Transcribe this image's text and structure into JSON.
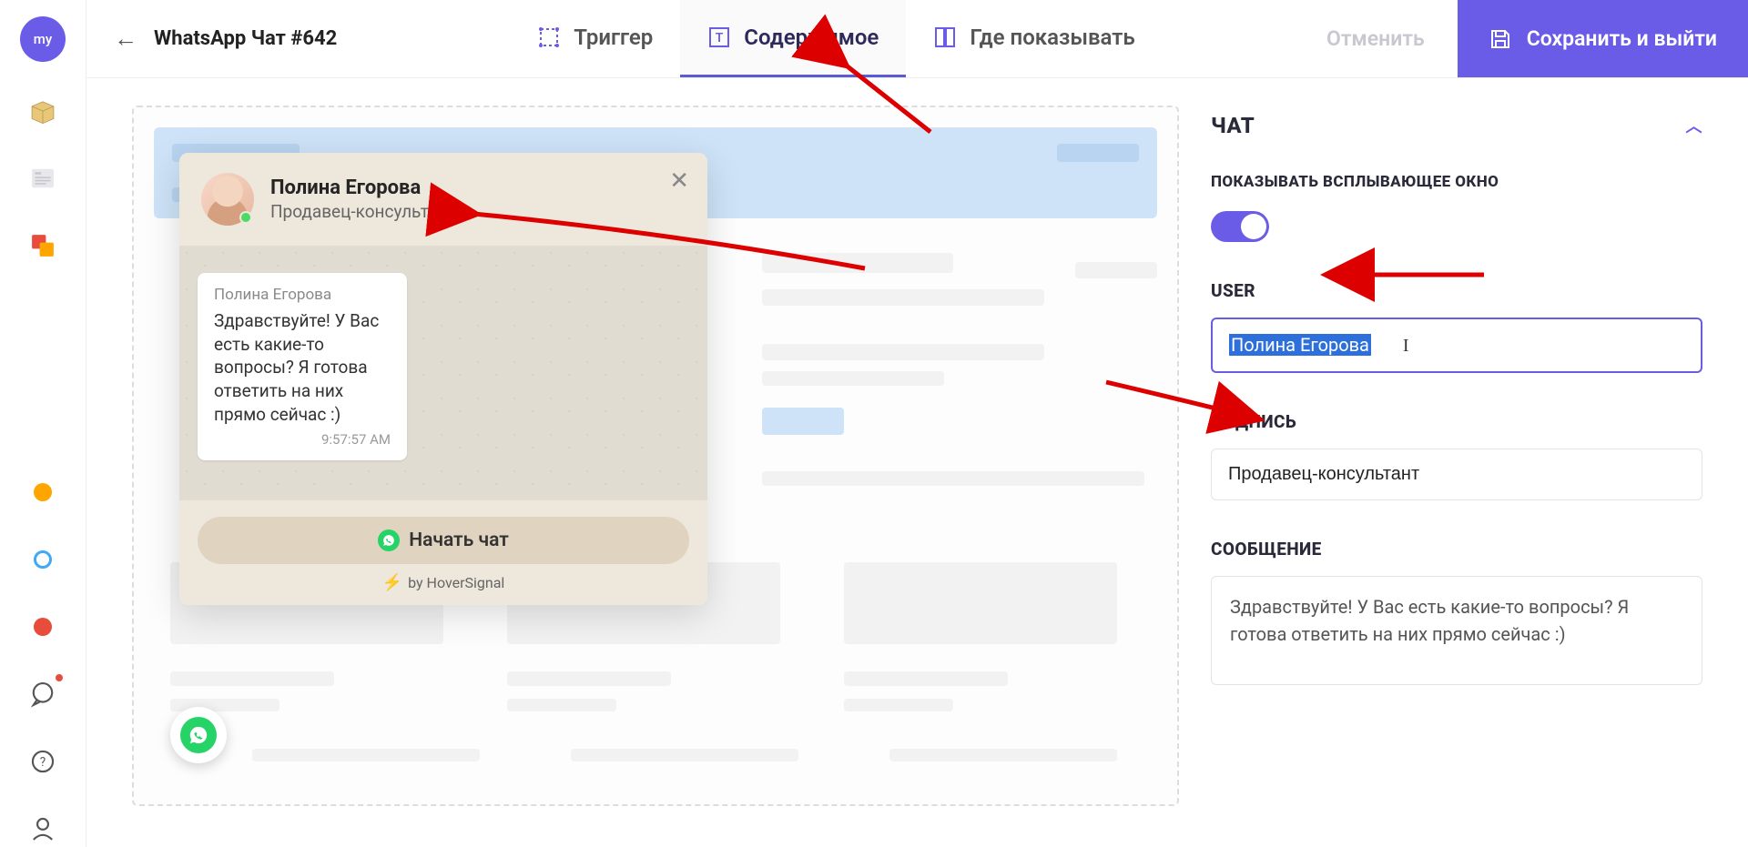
{
  "rail": {
    "logo": "my"
  },
  "header": {
    "title": "WhatsApp Чат #642",
    "tabs": {
      "trigger": "Триггер",
      "content": "Содержимое",
      "where": "Где показывать"
    },
    "cancel": "Отменить",
    "save": "Сохранить и выйти"
  },
  "preview": {
    "name": "Полина Егорова",
    "role": "Продавец-консультант",
    "msg_from": "Полина Егорова",
    "msg_text": "Здравствуйте! У Вас есть какие-то вопросы? Я готова ответить на них прямо сейчас :)",
    "msg_time": "9:57:57 AM",
    "start_chat": "Начать чат",
    "brand": "by HoverSignal"
  },
  "panel": {
    "section_chat": "ЧАТ",
    "popup_label": "ПОКАЗЫВАТЬ ВСПЛЫВАЮЩЕЕ ОКНО",
    "user_label": "USER",
    "user_value": "Полина Егорова",
    "sign_label": "ПОДПИСЬ",
    "sign_value": "Продавец-консультант",
    "message_label": "СООБЩЕНИЕ",
    "message_value": "Здравствуйте! У Вас есть какие-то вопросы? Я готова ответить на них прямо сейчас :)"
  }
}
